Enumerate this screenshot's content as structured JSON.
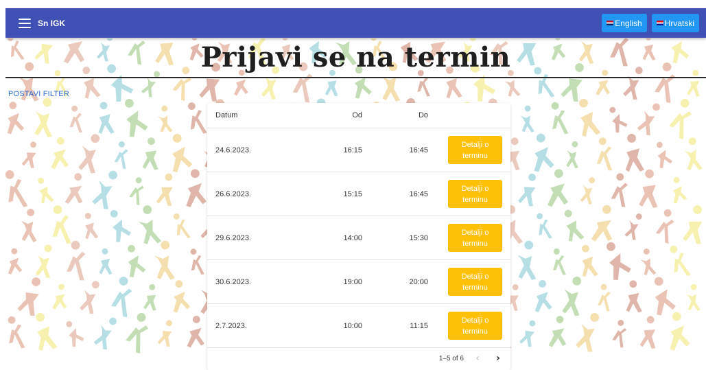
{
  "appbar": {
    "menu_icon": "hamburger-menu-icon",
    "title": "Sn IGK",
    "lang_english": "English",
    "lang_croatian": "Hrvatski",
    "color": "#3f51b5"
  },
  "heading": "Prijavi se na termin",
  "filter_label": "POSTAVI FILTER",
  "table": {
    "headers": {
      "date": "Datum",
      "od": "Od",
      "do": "Do"
    },
    "rows": [
      {
        "date": "24.6.2023.",
        "od": "16:15",
        "do": "16:45",
        "action": "Detalji o terminu"
      },
      {
        "date": "26.6.2023.",
        "od": "15:15",
        "do": "16:45",
        "action": "Detalji o terminu"
      },
      {
        "date": "29.6.2023.",
        "od": "14:00",
        "do": "15:30",
        "action": "Detalji o terminu"
      },
      {
        "date": "30.6.2023.",
        "od": "19:00",
        "do": "20:00",
        "action": "Detalji o terminu"
      },
      {
        "date": "2.7.2023.",
        "od": "10:00",
        "do": "11:15",
        "action": "Detalji o terminu"
      }
    ],
    "pagination": "1–5 of 6",
    "button_color": "#ffc107"
  }
}
